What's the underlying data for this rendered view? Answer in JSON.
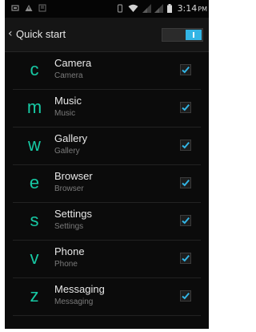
{
  "status_bar": {
    "time": "3:14",
    "time_suffix": "PM",
    "icons": [
      "notification-icon",
      "warning-icon",
      "screenshot-icon",
      "vibrate-icon",
      "wifi-icon",
      "signal-icon",
      "signal-icon",
      "battery-icon"
    ]
  },
  "header": {
    "back_glyph": "‹",
    "title": "Quick start",
    "master_switch_on": true
  },
  "colors": {
    "accent": "#33b5e5",
    "letter": "#17c9a4"
  },
  "items": [
    {
      "letter": "c",
      "name": "Camera",
      "subtitle": "Camera",
      "checked": true
    },
    {
      "letter": "m",
      "name": "Music",
      "subtitle": "Music",
      "checked": true
    },
    {
      "letter": "w",
      "name": "Gallery",
      "subtitle": "Gallery",
      "checked": true
    },
    {
      "letter": "e",
      "name": "Browser",
      "subtitle": "Browser",
      "checked": true
    },
    {
      "letter": "s",
      "name": "Settings",
      "subtitle": "Settings",
      "checked": true
    },
    {
      "letter": "v",
      "name": "Phone",
      "subtitle": "Phone",
      "checked": true
    },
    {
      "letter": "z",
      "name": "Messaging",
      "subtitle": "Messaging",
      "checked": true
    }
  ]
}
